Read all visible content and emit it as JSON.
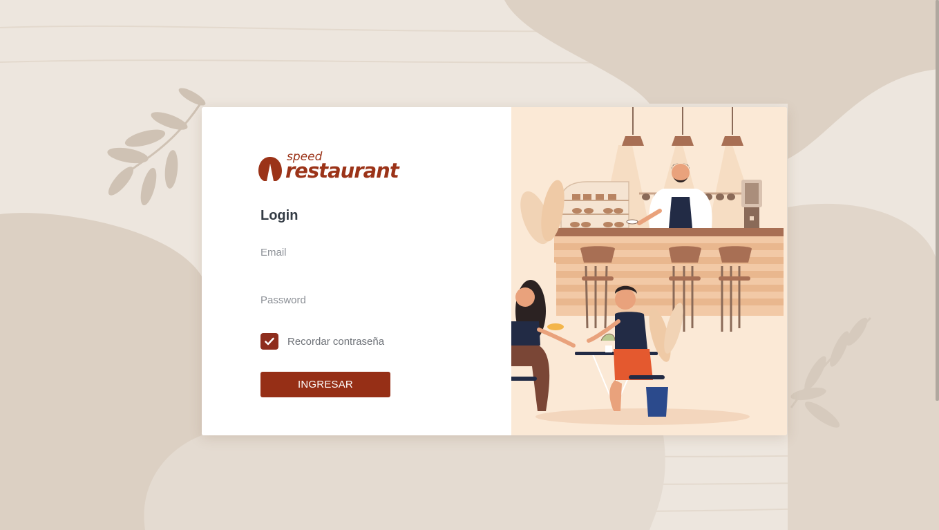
{
  "brand": {
    "small_text": "speed",
    "name": "restaurant",
    "color": "#9b3318"
  },
  "login": {
    "title": "Login",
    "email_placeholder": "Email",
    "email_value": "",
    "password_placeholder": "Password",
    "password_value": "",
    "remember_label": "Recordar contraseña",
    "remember_checked": true,
    "submit_label": "INGRESAR"
  },
  "colors": {
    "accent": "#962f16",
    "checkbox": "#8e2d1d",
    "illustration_bg": "#fbe9d6",
    "page_bg": "#e9e0d6"
  },
  "illustration": {
    "subject": "cafe-scene-barista-and-two-customers"
  }
}
